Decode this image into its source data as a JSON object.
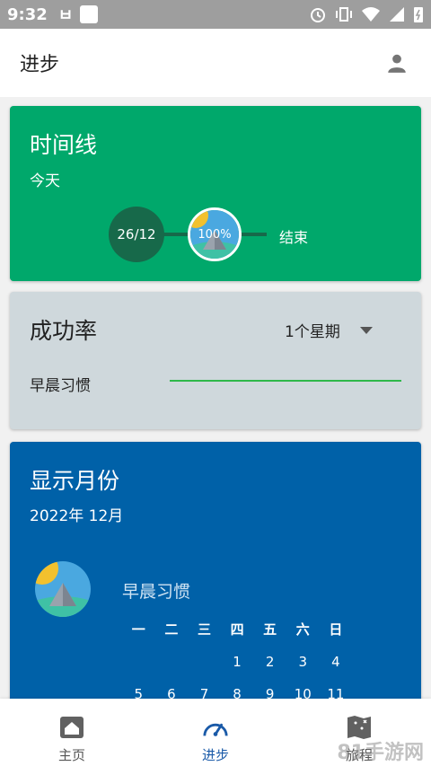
{
  "status_bar": {
    "time": "9:32",
    "carrier_glyph": "ㅂ"
  },
  "header": {
    "title": "进步",
    "profile_icon": "person-icon"
  },
  "timeline_card": {
    "title": "时间线",
    "subtitle": "今天",
    "start_label": "26/12",
    "progress_label": "100%",
    "progress_value": 100,
    "end_label": "结束",
    "color": "#00a86b"
  },
  "success_card": {
    "title": "成功率",
    "period": "1个星期",
    "habits": [
      {
        "name": "早晨习惯",
        "rate": 1.0
      }
    ],
    "color": "#cfd8dc"
  },
  "month_card": {
    "title": "显示月份",
    "subtitle": "2022年 12月",
    "habit_name": "早晨习惯",
    "weekdays": [
      "一",
      "二",
      "三",
      "四",
      "五",
      "六",
      "日"
    ],
    "weeks": [
      [
        "",
        "",
        "",
        "1",
        "2",
        "3",
        "4"
      ],
      [
        "5",
        "6",
        "7",
        "8",
        "9",
        "10",
        "11"
      ]
    ],
    "color": "#0061a8"
  },
  "bottom_nav": {
    "items": [
      {
        "label": "主页",
        "icon": "home-icon"
      },
      {
        "label": "进步",
        "icon": "speedometer-icon",
        "active": true
      },
      {
        "label": "旅程",
        "icon": "map-icon"
      }
    ]
  },
  "watermark": "81手游网"
}
